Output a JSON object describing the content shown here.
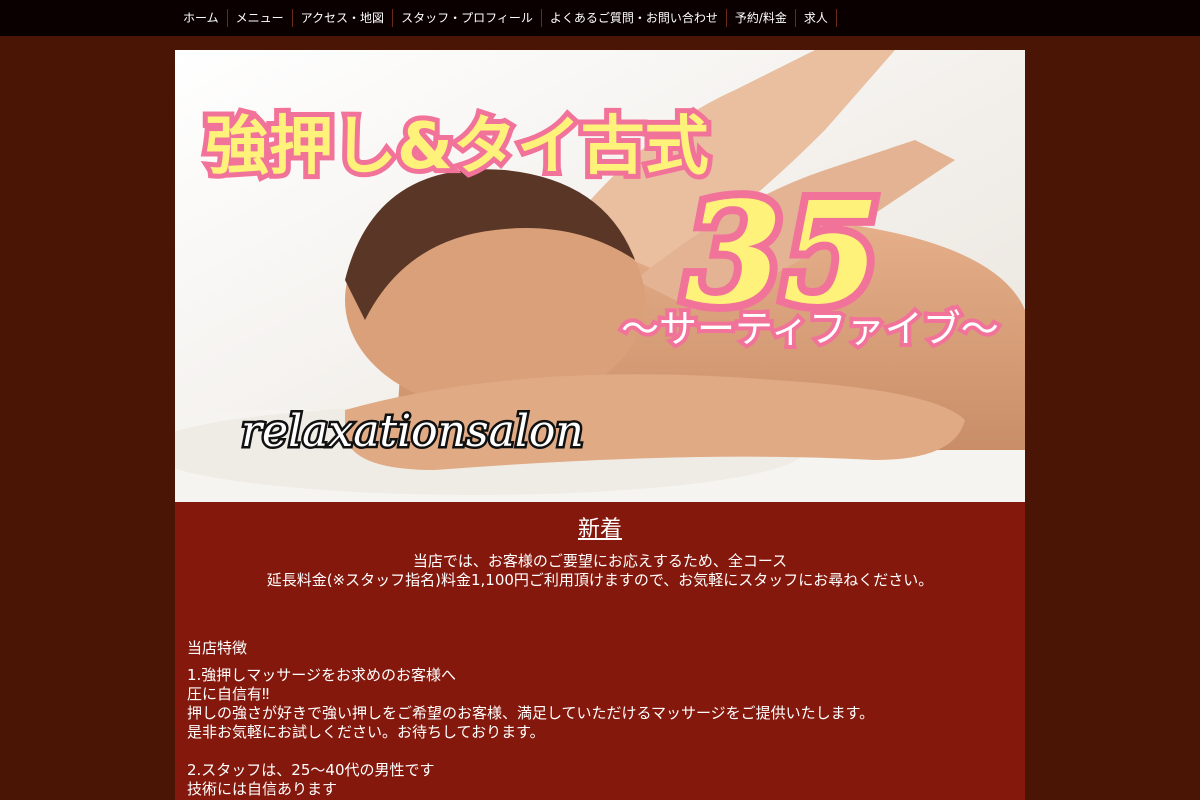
{
  "nav": {
    "items": [
      "ホーム",
      "メニュー",
      "アクセス・地図",
      "スタッフ・プロフィール",
      "よくあるご質問・お問い合わせ",
      "予約/料金",
      "求人"
    ]
  },
  "hero": {
    "headline": "強押し&タイ古式",
    "number": "35",
    "subtitle": "〜サーティファイブ〜",
    "script": "relaxationsalon"
  },
  "panel": {
    "title": "新着",
    "intro_line1": "当店では、お客様のご要望にお応えするため、全コース",
    "intro_line2": "延長料金(※スタッフ指名)料金1,100円ご利用頂けますので、お気軽にスタッフにお尋ねください。",
    "feature_label": "当店特徴",
    "item1_line1": "1.強押しマッサージをお求めのお客様へ",
    "item1_line2": "圧に自信有‼",
    "item1_line3": "押しの強さが好きで強い押しをご希望のお客様、満足していただけるマッサージをご提供いたします。",
    "item1_line4": "是非お気軽にお試しください。お待ちしております。",
    "item2_line1": "2.スタッフは、25〜40代の男性です",
    "item2_line2": "技術には自信あります"
  }
}
